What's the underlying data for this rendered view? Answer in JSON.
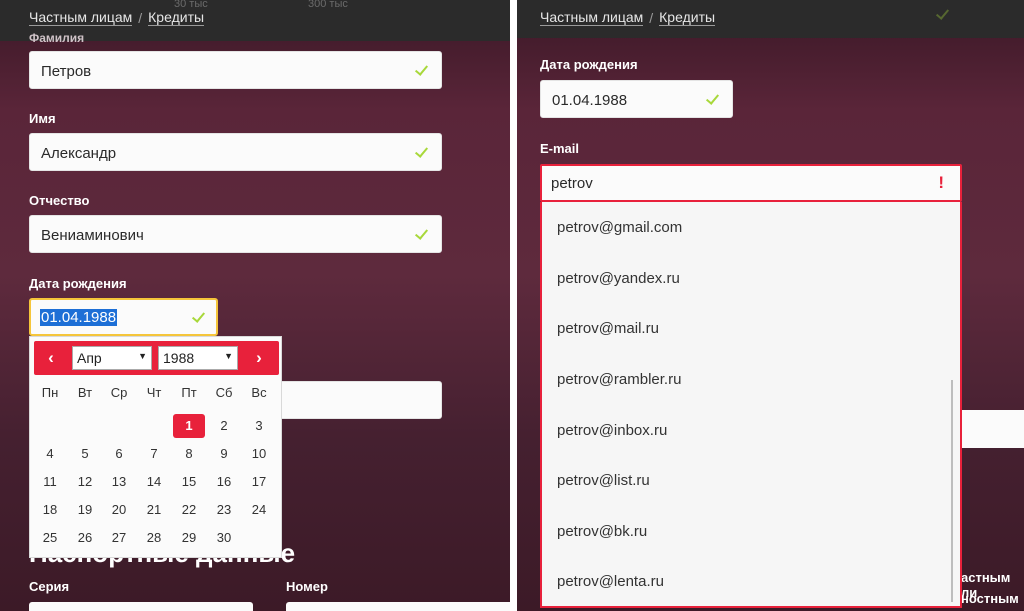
{
  "breadcrumbs": [
    "Частным лицам",
    "Кредиты"
  ],
  "breadcrumb_sep": "/",
  "ghost_values": [
    "30 тыс",
    "300 тыс"
  ],
  "left_form": {
    "lastname": {
      "label": "Фамилия",
      "value": "Петров"
    },
    "firstname": {
      "label": "Имя",
      "value": "Александр"
    },
    "patronymic": {
      "label": "Отчество",
      "value": "Вениаминович"
    },
    "birthdate": {
      "label": "Дата рождения",
      "value": "01.04.1988"
    }
  },
  "calendar": {
    "prev": "‹",
    "next": "›",
    "month": "Апр",
    "year": "1988",
    "weekdays": [
      "Пн",
      "Вт",
      "Ср",
      "Чт",
      "Пт",
      "Сб",
      "Вс"
    ],
    "selected_day": "1",
    "weeks": [
      [
        "",
        "",
        "",
        "",
        "1",
        "2",
        "3"
      ],
      [
        "4",
        "5",
        "6",
        "7",
        "8",
        "9",
        "10"
      ],
      [
        "11",
        "12",
        "13",
        "14",
        "15",
        "16",
        "17"
      ],
      [
        "18",
        "19",
        "20",
        "21",
        "22",
        "23",
        "24"
      ],
      [
        "25",
        "26",
        "27",
        "28",
        "29",
        "30",
        ""
      ]
    ]
  },
  "passport": {
    "title": "Паспортные данные",
    "series_label": "Серия",
    "number_label": "Номер"
  },
  "right_form": {
    "birthdate": {
      "label": "Дата рождения",
      "value": "01.04.1988"
    },
    "email": {
      "label": "E-mail",
      "value": "petrov",
      "error_icon": "!"
    },
    "suggestions": [
      "petrov@gmail.com",
      "petrov@yandex.ru",
      "petrov@mail.ru",
      "petrov@rambler.ru",
      "petrov@inbox.ru",
      "petrov@list.ru",
      "petrov@bk.ru",
      "petrov@lenta.ru"
    ],
    "cut_labels": [
      "астным ли",
      "ностным"
    ]
  },
  "colors": {
    "accent": "#e8213b",
    "check": "#a8d83a",
    "focus": "#f5c53a",
    "selection": "#1d6fd6"
  }
}
